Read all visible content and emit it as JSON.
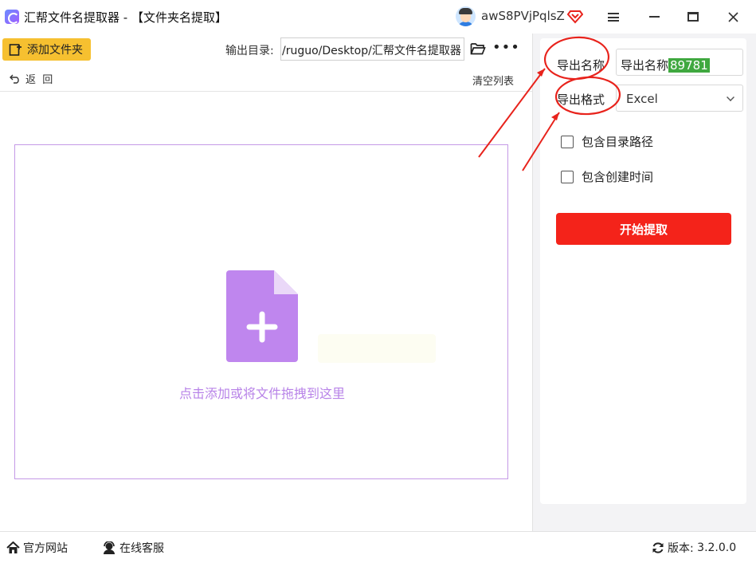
{
  "window": {
    "title": "汇帮文件名提取器 - 【文件夹名提取】",
    "username": "awS8PVjPqlsZ"
  },
  "toolbar": {
    "add_folder_label": "添加文件夹",
    "output_dir_label": "输出目录:",
    "output_dir_value": "/ruguo/Desktop/汇帮文件名提取器",
    "back_label": "返  回",
    "clear_list_label": "清空列表"
  },
  "dropzone": {
    "hint": "点击添加或将文件拖拽到这里"
  },
  "settings": {
    "export_name_label": "导出名称",
    "export_name_value_prefix": "导出名称",
    "export_name_value_highlight": "89781",
    "export_format_label": "导出格式",
    "export_format_value": "Excel",
    "include_dir_path_label": "包含目录路径",
    "include_create_time_label": "包含创建时间",
    "include_dir_path_checked": false,
    "include_create_time_checked": false,
    "start_button_label": "开始提取"
  },
  "statusbar": {
    "website_label": "官方网站",
    "service_label": "在线客服",
    "version_label": "版本:",
    "version_value": "3.2.0.0"
  },
  "colors": {
    "accent_yellow": "#f6c030",
    "start_red": "#f4231a",
    "drop_purple": "#b883e8",
    "annotation_red": "#e8231c"
  }
}
